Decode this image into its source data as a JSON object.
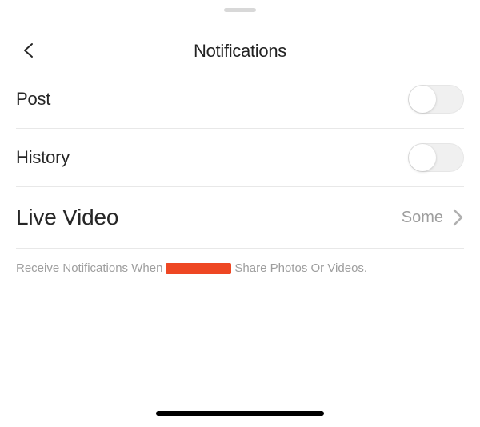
{
  "header": {
    "title": "Notifications"
  },
  "rows": {
    "post": {
      "label": "Post",
      "on": false
    },
    "history": {
      "label": "History",
      "on": false
    },
    "live": {
      "label": "Live Video",
      "value": "Some"
    }
  },
  "footer": {
    "prefix": "Receive Notifications When",
    "suffix": "Share Photos Or Videos."
  }
}
